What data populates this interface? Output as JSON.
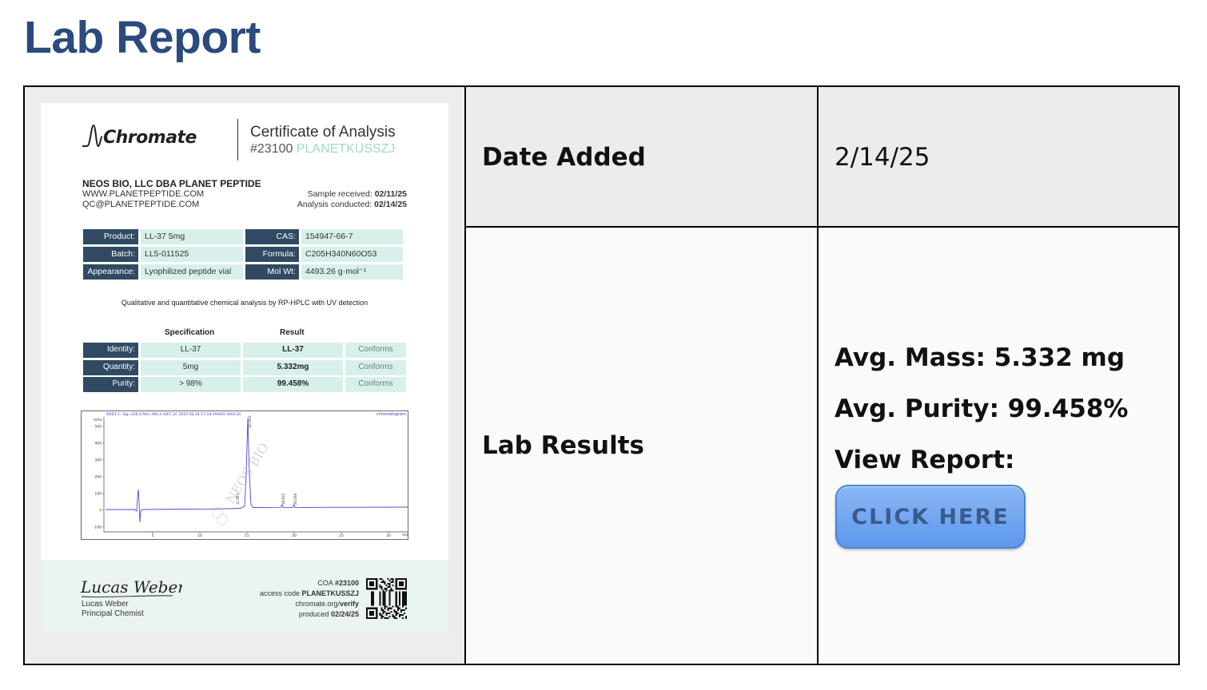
{
  "page": {
    "title": "Lab Report"
  },
  "table": {
    "date_label": "Date Added",
    "date_value": "2/14/25",
    "results_label": "Lab Results",
    "avg_mass": "Avg. Mass: 5.332 mg",
    "avg_purity": "Avg. Purity: 99.458%",
    "view_report": "View Report:",
    "button_label": "CLICK HERE"
  },
  "certificate": {
    "logo_text": "Chromate",
    "heading": "Certificate of Analysis",
    "number": "#23100",
    "code": "PLANETKUSSZJ",
    "company": {
      "name": "NEOS BIO, LLC DBA PLANET PEPTIDE",
      "website": "WWW.PLANETPEPTIDE.COM",
      "email": "QC@PLANETPEPTIDE.COM"
    },
    "sample_received_label": "Sample received:",
    "sample_received_date": "02/11/25",
    "analysis_conducted_label": "Analysis conducted:",
    "analysis_conducted_date": "02/14/25",
    "info_rows": [
      {
        "label": "Product:",
        "value": "LL-37 5mg",
        "label2": "CAS:",
        "value2": "154947-66-7"
      },
      {
        "label": "Batch:",
        "value": "LL5-011525",
        "label2": "Formula:",
        "value2": "C205H340N60O53"
      },
      {
        "label": "Appearance:",
        "value": "Lyophilized peptide vial",
        "label2": "Mol Wt:",
        "value2": "4493.26 g·mol⁻¹"
      }
    ],
    "method": "Qualitative and quantitative chemical analysis by RP-HPLC with UV detection",
    "spec_header": "Specification",
    "result_header": "Result",
    "tests": [
      {
        "label": "Identity:",
        "spec": "LL-37",
        "result": "LL-37",
        "status": "Conforms"
      },
      {
        "label": "Quantity:",
        "spec": "5mg",
        "result": "5.332mg",
        "status": "Conforms"
      },
      {
        "label": "Purity:",
        "spec": "> 98%",
        "result": "99.458%",
        "status": "Conforms"
      }
    ],
    "chromatogram": {
      "header": "DAD1 C, Sig=220,4 Ref=360,4 (DEF_LC 2025-02-14 17-18-59\\062-5601.D)",
      "tag": "chromatogram",
      "y_unit": "mAU",
      "x_unit": "min",
      "y_ticks": [
        "500",
        "400",
        "300",
        "200",
        "100",
        "0",
        "-100"
      ],
      "x_ticks": [
        "5",
        "10",
        "15",
        "20",
        "25",
        "30"
      ],
      "peak_labels": [
        "11.903",
        "18.815",
        "20.008"
      ],
      "main_peak_label": "10.902",
      "watermark": "NEOS BIO",
      "trace_color": "#4a4ad8"
    },
    "signature_text": "Lucas Weber",
    "signer_name": "Lucas Weber",
    "signer_title": "Principal Chemist",
    "coa_label": "COA",
    "coa_number": "#23100",
    "access_code_label": "access code",
    "access_code": "PLANETKUSSZJ",
    "verify_domain": "chromate.org/",
    "verify_path": "verify",
    "produced_label": "produced",
    "produced_date": "02/24/25"
  },
  "colors": {
    "title": "#2b4a7e",
    "button": "#6fa3ef",
    "label_dark": "#2f4a62",
    "value_mint": "#d8f0eb"
  }
}
